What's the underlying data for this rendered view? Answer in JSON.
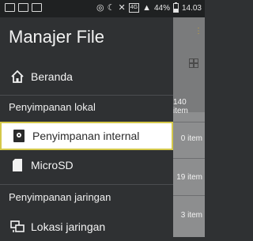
{
  "status": {
    "battery_percent": "44%",
    "time": "14.03",
    "network_badge": "4G"
  },
  "drawer": {
    "title": "Manajer File",
    "items": {
      "home": "Beranda",
      "internal": "Penyimpanan internal",
      "sd": "MicroSD",
      "network": "Lokasi jaringan"
    },
    "sections": {
      "local": "Penyimpanan lokal",
      "network": "Penyimpanan jaringan"
    }
  },
  "background_list": {
    "counts": [
      "140 item",
      "0 item",
      "19 item",
      "3 item"
    ]
  },
  "colors": {
    "drawer_bg": "#2f3133",
    "selected_border": "#d4c84a",
    "accent_dots": "#c8a33a"
  },
  "icons": {
    "home": "home-icon",
    "internal": "phone-storage-icon",
    "sd": "sd-card-icon",
    "network": "network-location-icon"
  }
}
